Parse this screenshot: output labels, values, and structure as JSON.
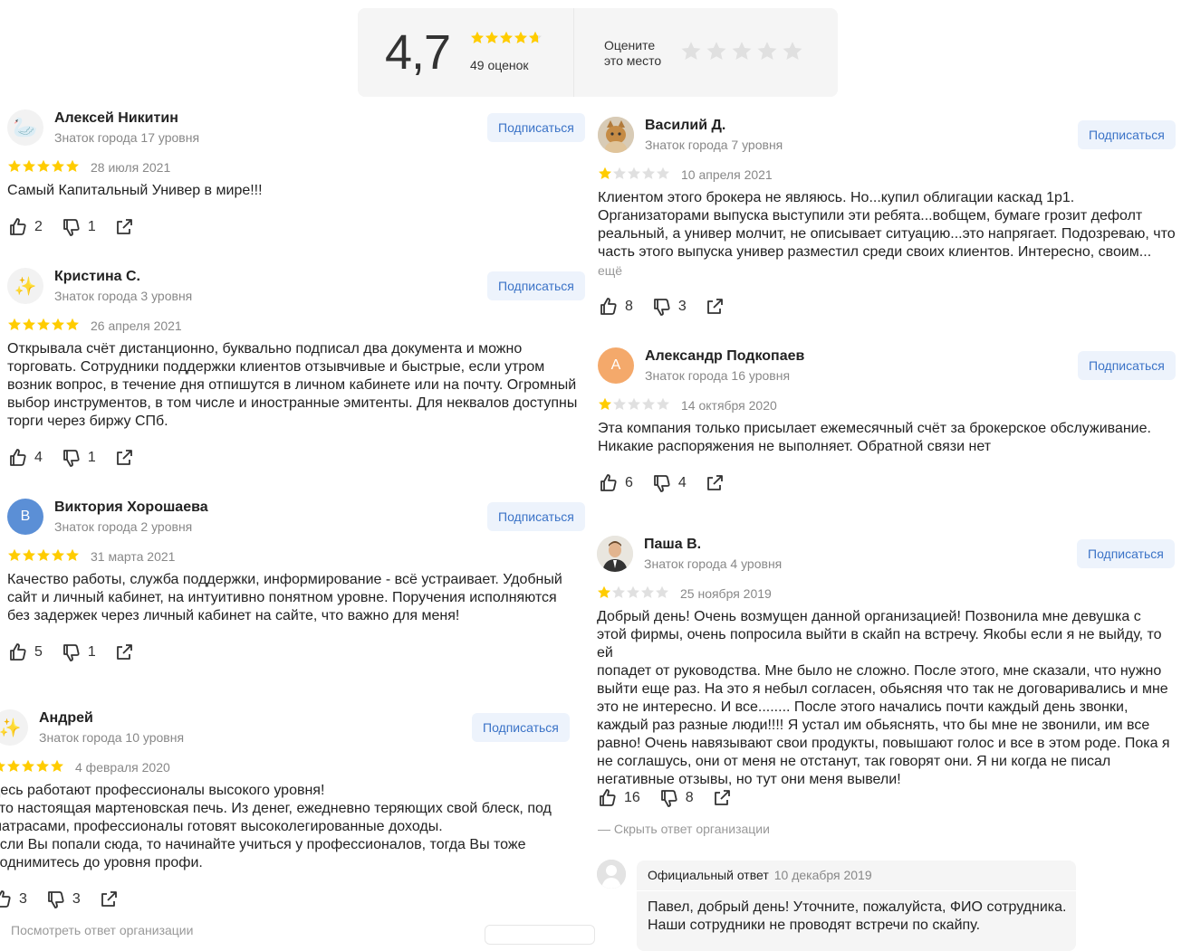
{
  "summary": {
    "rating": "4,7",
    "stars": 4.7,
    "count": "49 оценок",
    "rate_label": "Оцените\nэто место"
  },
  "colors": {
    "star_active": "#fc0",
    "star_inactive": "#e0e0e0",
    "link": "#3b73c7",
    "button_bg": "#edf3fc",
    "avatar_orange": "#f4a96b",
    "avatar_blue": "#5b8fd6"
  },
  "subscribe_label": "Подписаться",
  "show_more_label": "ещё",
  "reviews": [
    {
      "name": "Алексей Никитин",
      "level": "Знаток города 17 уровня",
      "avatar_icon": "goose-icon",
      "rating": 5,
      "date": "28 июля 2021",
      "text": "Самый Капитальный Универ в мире!!!",
      "likes": "2",
      "dislikes": "1"
    },
    {
      "name": "Кристина С.",
      "level": "Знаток города 3 уровня",
      "avatar_icon": "sparkles-icon",
      "rating": 5,
      "date": "26 апреля 2021",
      "text": "Открывала счёт дистанционно, буквально подписал два документа и можно\nторговать. Сотрудники поддержки клиентов отзывчивые и быстрые, если утром\nвозник вопрос, в течение дня отпишутся в личном кабинете или на почту. Огромный\nвыбор инструментов, в том числе и иностранные эмитенты. Для неквалов доступны\nторги через биржу СПб.",
      "likes": "4",
      "dislikes": "1"
    },
    {
      "name": "Виктория Хорошаева",
      "level": "Знаток города 2 уровня",
      "avatar_letter": "В",
      "rating": 5,
      "date": "31 марта 2021",
      "text": "Качество работы, служба поддержки, информирование - всё устраивает. Удобный\nсайт и личный кабинет, на интуитивно понятном уровне. Поручения исполняются\nбез задержек через личный кабинет на сайте, что важно для меня!",
      "likes": "5",
      "dislikes": "1"
    },
    {
      "name": "Андрей",
      "level": "Знаток города 10 уровня",
      "avatar_icon": "sparkles-icon",
      "rating": 5,
      "date": "4 февраля 2020",
      "text": "десь работают профессионалы высокого уровня!\nэто настоящая мартеновская печь. Из денег, ежедневно теряющих свой блеск, под\nматрасами, профессионалы готовят высоколегированные доходы.\nесли Вы попали сюда, то начинайте учиться у профессионалов, тогда Вы тоже\nподнимитесь до уровня профи.",
      "likes": "3",
      "dislikes": "3",
      "org_toggle": "Посмотреть ответ организации"
    },
    {
      "name": "Василий Д.",
      "level": "Знаток города 7 уровня",
      "avatar_icon": "cat-photo-icon",
      "rating": 1,
      "date": "10 апреля 2021",
      "text": "Клиентом этого брокера не являюсь. Но...купил облигации каскад 1р1.\nОрганизаторами выпуска выступили эти ребята...вобщем, бумаге грозит дефолт\nреальный, а универ молчит, не описывает ситуацию...это напрягает. Подозреваю, что\nчасть этого выпуска универ разместил среди своих клиентов. Интересно, своим...",
      "likes": "8",
      "dislikes": "3"
    },
    {
      "name": "Александр Подкопаев",
      "level": "Знаток города 16 уровня",
      "avatar_letter": "А",
      "rating": 1,
      "date": "14 октября 2020",
      "text": "Эта компания только присылает ежемесячный счёт за брокерское обслуживание.\nНикакие распоряжения не выполняет. Обратной связи нет",
      "likes": "6",
      "dislikes": "4"
    },
    {
      "name": "Паша В.",
      "level": "Знаток города 4 уровня",
      "avatar_icon": "man-photo-icon",
      "rating": 1,
      "date": "25 ноября 2019",
      "text": "Добрый день! Очень возмущен данной организацией! Позвонила мне девушка с\nэтой фирмы, очень попросила выйти в скайп на встречу. Якобы если я не выйду, то ей\nпопадет от руководства. Мне было не сложно. После этого, мне сказали, что нужно\nвыйти еще раз. На это я небыл согласен, обьясняя что так не договаривались и мне\nэто не интересно. И все........ После этого начались почти каждый день звонки,\nкаждый раз разные люди!!!! Я устал им обьяснять, что бы мне не звонили, им все\nравно! Очень навязывают свои продукты, повышают голос и все в этом роде. Пока я\nне соглашусь, они от меня не отстанут, так говорят они. Я ни когда не писал\nнегативные отзывы, но тут они меня вывели!",
      "likes": "16",
      "dislikes": "8",
      "org_toggle": "— Скрыть ответ организации"
    }
  ],
  "official_reply": {
    "label": "Официальный ответ",
    "date": "10 декабря 2019",
    "text": "Павел, добрый день! Уточните, пожалуйста, ФИО сотрудника.\nНаши сотрудники не проводят встречи по скайпу."
  }
}
